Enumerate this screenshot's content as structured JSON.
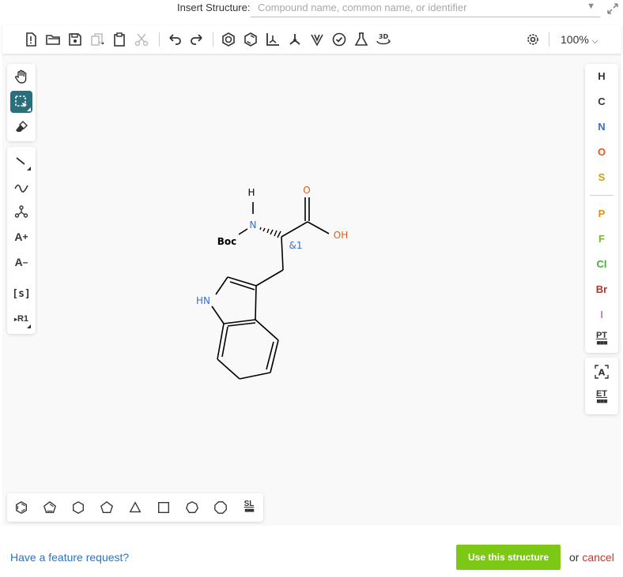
{
  "insert": {
    "label": "Insert Structure:",
    "placeholder": "Compound name, common name, or identifier"
  },
  "toolbar": {
    "zoom": "100%",
    "icons": [
      "new-file-icon",
      "open-icon",
      "save-icon",
      "copy-icon",
      "paste-icon",
      "cut-icon",
      "undo-icon",
      "redo-icon",
      "aromatize-icon",
      "dearomatize-icon",
      "layout-icon",
      "clean-icon",
      "stereo-icon",
      "check-icon",
      "calculate-icon",
      "3d-view-icon",
      "settings-icon"
    ]
  },
  "left_panel": {
    "rgroup_label": "R1",
    "sgroup_label": "[s]",
    "charge_plus": "A",
    "charge_minus": "A"
  },
  "atoms": {
    "list": [
      {
        "symbol": "H",
        "color": "#000000"
      },
      {
        "symbol": "C",
        "color": "#000000"
      },
      {
        "symbol": "N",
        "color": "#3a6fc9"
      },
      {
        "symbol": "O",
        "color": "#e35b13"
      },
      {
        "symbol": "S",
        "color": "#c9a30f"
      },
      {
        "symbol": "P",
        "color": "#e38c13"
      },
      {
        "symbol": "F",
        "color": "#78b53a"
      },
      {
        "symbol": "Cl",
        "color": "#3fb22f"
      },
      {
        "symbol": "Br",
        "color": "#a23a2c"
      },
      {
        "symbol": "I",
        "color": "#9a3bb0"
      }
    ],
    "periodic_table": "PT",
    "extended_table": "ET"
  },
  "bottom_panel": {
    "shapes": [
      "benzene",
      "cyclopentadiene",
      "cyclohexane",
      "cyclopentane",
      "cyclopropane",
      "cyclobutane",
      "cycloheptane",
      "cyclooctane"
    ],
    "structure_library": "SL"
  },
  "molecule": {
    "labels": {
      "h": "H",
      "n": "N",
      "boc": "Boc",
      "o": "O",
      "oh": "OH",
      "stereo": "&1",
      "hn": "HN"
    }
  },
  "footer": {
    "feature_request": "Have a feature request?",
    "use_button": "Use this structure",
    "or": "or",
    "cancel": "cancel"
  }
}
